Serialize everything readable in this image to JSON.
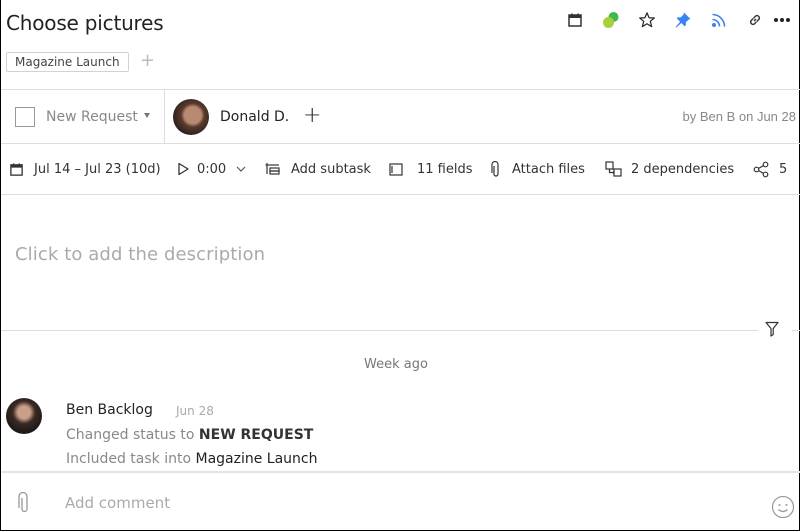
{
  "task": {
    "title": "Choose pictures",
    "tags": [
      "Magazine Launch"
    ],
    "add_tag_icon": "plus-icon"
  },
  "toolbar_icons": [
    {
      "name": "calendar-icon",
      "color": "#333333"
    },
    {
      "name": "workflow-circles-icon",
      "color": "#6cc24a"
    },
    {
      "name": "star-icon",
      "color": "#333333"
    },
    {
      "name": "pin-icon",
      "color": "#3b82f6"
    },
    {
      "name": "rss-feed-icon",
      "color": "#3b82f6"
    },
    {
      "name": "link-icon",
      "color": "#333333"
    },
    {
      "name": "more-icon",
      "color": "#333333"
    }
  ],
  "status": {
    "label": "New Request"
  },
  "assignee": {
    "name": "Donald D."
  },
  "author_text": "by Ben B on Jun 28",
  "meta": {
    "dates": "Jul 14 – Jul 23 (10d)",
    "timer": "0:00",
    "add_subtask": "Add subtask",
    "fields": "11 fields",
    "attach": "Attach files",
    "dependencies": "2 dependencies",
    "shares": "5"
  },
  "description_placeholder": "Click to add the description",
  "activity": {
    "group_label": "Week ago",
    "entries": [
      {
        "author": "Ben Backlog",
        "date": "Jun 28",
        "line1_prefix": "Changed status to ",
        "line1_value": "NEW REQUEST",
        "line2_prefix": "Included task into ",
        "line2_value": "Magazine Launch"
      }
    ]
  },
  "comment": {
    "placeholder": "Add comment"
  }
}
